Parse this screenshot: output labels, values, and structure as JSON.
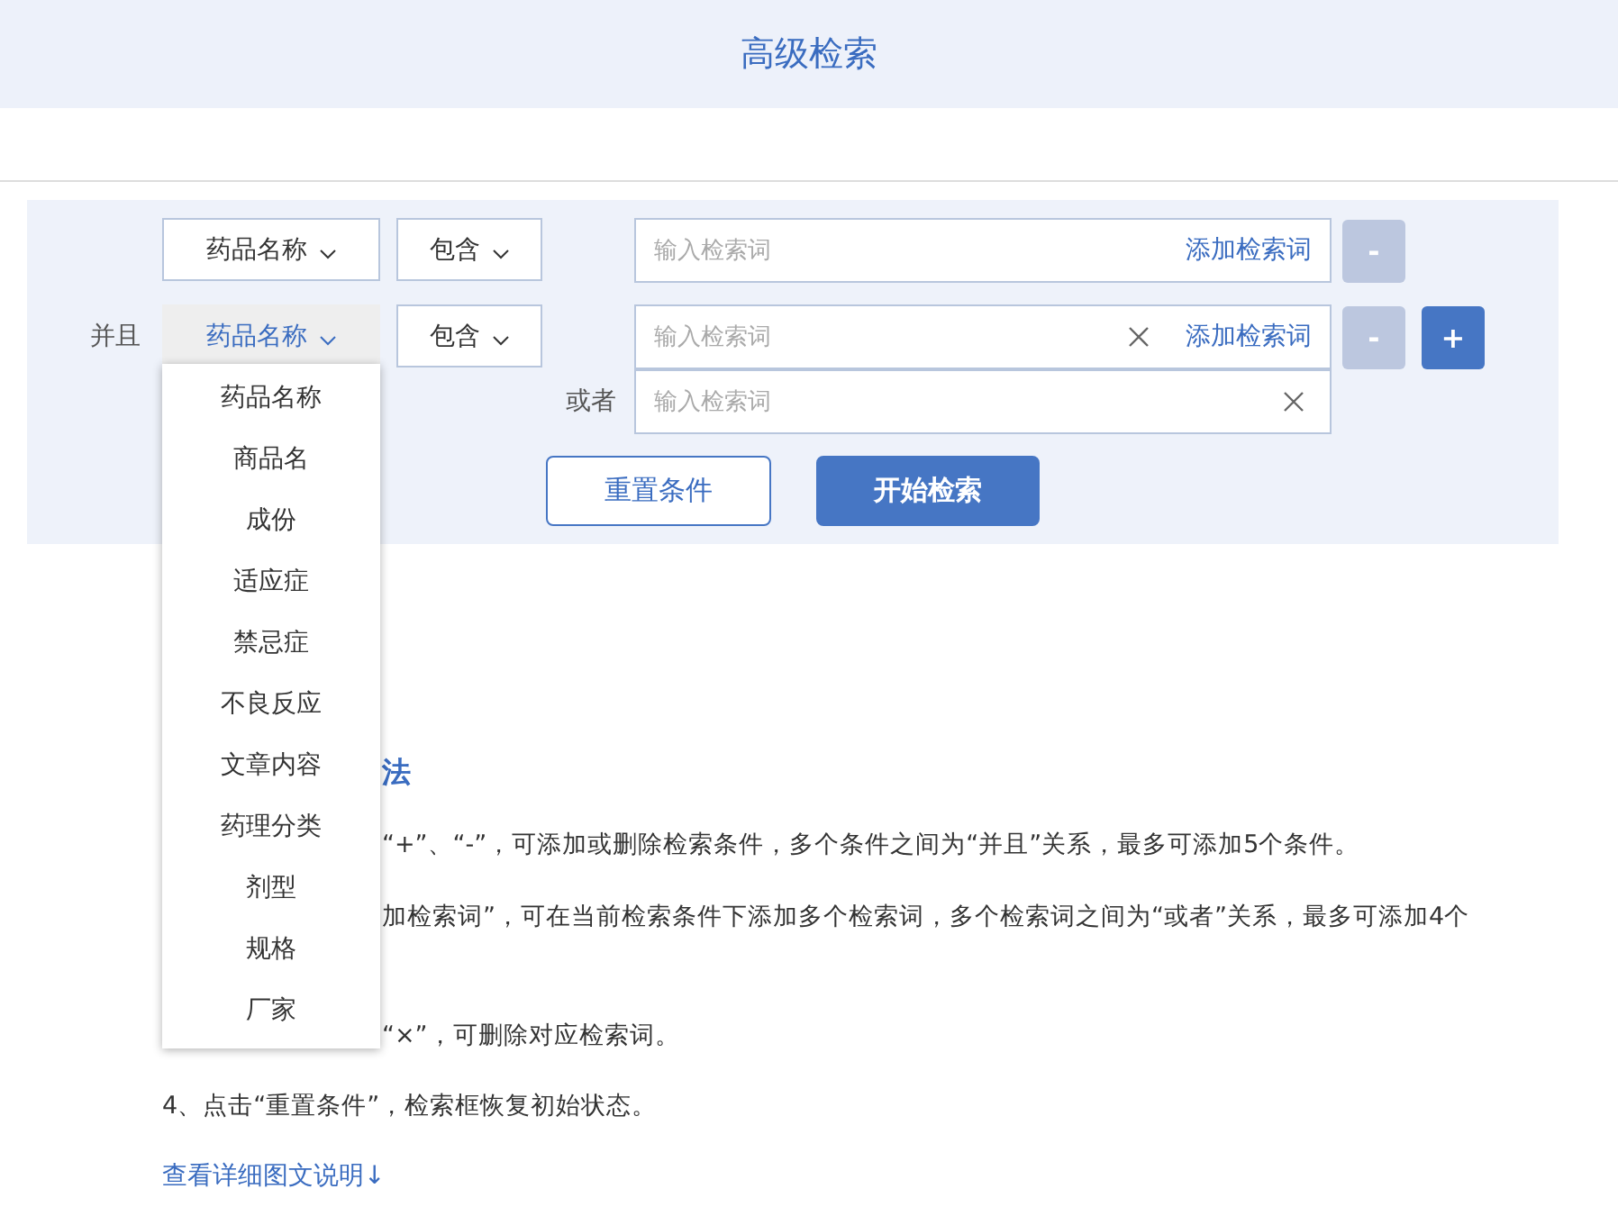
{
  "title": "高级检索",
  "conditions": [
    {
      "field": {
        "label": "药品名称",
        "open": false
      },
      "operator": {
        "label": "包含",
        "open": false
      },
      "add_term": "添加检索词",
      "terms": [
        {
          "placeholder": "输入检索词",
          "removable": false
        }
      ],
      "buttons": [
        {
          "kind": "minus",
          "label": "-"
        }
      ]
    },
    {
      "connector": "并且",
      "field": {
        "label": "药品名称",
        "open": true
      },
      "operator": {
        "label": "包含",
        "open": false
      },
      "add_term": "添加检索词",
      "terms": [
        {
          "placeholder": "输入检索词",
          "removable": true
        },
        {
          "connector": "或者",
          "placeholder": "输入检索词",
          "removable": true
        }
      ],
      "buttons": [
        {
          "kind": "minus",
          "label": "-"
        },
        {
          "kind": "plus",
          "label": "+"
        }
      ]
    }
  ],
  "actions": [
    {
      "kind": "secondary",
      "label": "重置条件"
    },
    {
      "kind": "primary",
      "label": "开始检索"
    }
  ],
  "dropdown": {
    "items": [
      "药品名称",
      "商品名",
      "成份",
      "适应症",
      "禁忌症",
      "不良反应",
      "文章内容",
      "药理分类",
      "剂型",
      "规格",
      "厂家"
    ]
  },
  "help": {
    "heading": "法",
    "lines": [
      {
        "kind": "covered",
        "text": "“+”、“-”，可添加或删除检索条件，多个条件之间为“并且”关系，最多可添加5个条件。"
      },
      {
        "kind": "covered",
        "text": "加检索词”，可在当前检索条件下添加多个检索词，多个检索词之间为“或者”关系，最多可添加4个"
      },
      {
        "kind": "covered",
        "text": "“×”，可删除对应检索词。"
      },
      {
        "kind": "plain",
        "text": "4、点击“重置条件”，检索框恢复初始状态。"
      }
    ],
    "link": "查看详细图文说明↓"
  }
}
